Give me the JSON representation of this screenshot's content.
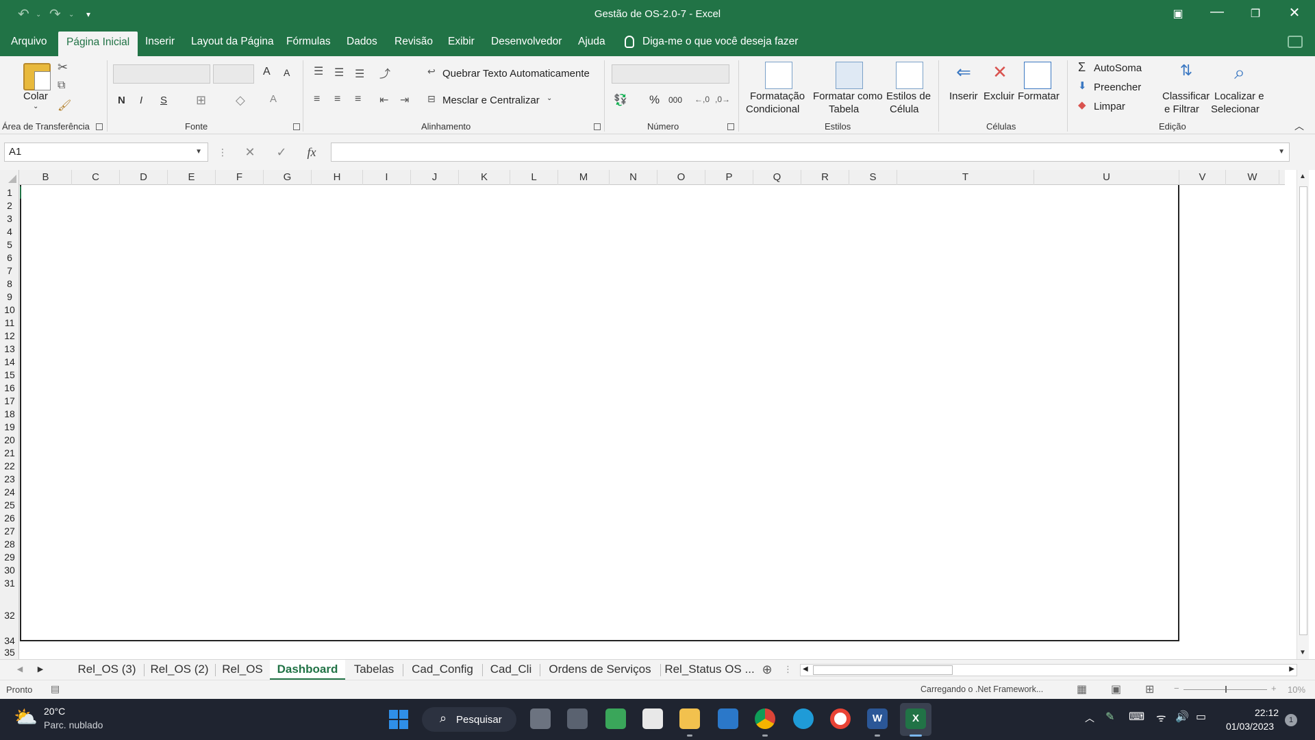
{
  "titlebar": {
    "title": "Gestão de OS-2.0-7  -  Excel",
    "undo_icon": "undo-icon",
    "redo_icon": "redo-icon",
    "customize_icon": "customize-qat-icon",
    "ribbon_display_icon": "ribbon-display-options-icon",
    "minimize_icon": "minimize-icon",
    "restore_icon": "restore-icon",
    "close_icon": "close-icon"
  },
  "menu": {
    "tabs": [
      "Arquivo",
      "Página Inicial",
      "Inserir",
      "Layout da Página",
      "Fórmulas",
      "Dados",
      "Revisão",
      "Exibir",
      "Desenvolvedor",
      "Ajuda"
    ],
    "active_tab": "Página Inicial",
    "tell_me": "Diga-me o que você deseja fazer"
  },
  "ribbon": {
    "clipboard": {
      "paste": "Colar",
      "group": "Área de Transferência"
    },
    "font": {
      "grow": "A",
      "shrink": "A",
      "bold": "N",
      "italic": "I",
      "underline": "S",
      "font_color": "A",
      "group": "Fonte"
    },
    "alignment": {
      "wrap_text": "Quebrar Texto Automaticamente",
      "merge_center": "Mesclar e Centralizar",
      "group": "Alinhamento"
    },
    "number": {
      "percent": "%",
      "thousands": "000",
      "group": "Número"
    },
    "styles": {
      "conditional_1": "Formatação",
      "conditional_2": "Condicional",
      "table_1": "Formatar como",
      "table_2": "Tabela",
      "cell_1": "Estilos de",
      "cell_2": "Célula",
      "group": "Estilos"
    },
    "cells": {
      "insert": "Inserir",
      "delete": "Excluir",
      "format": "Formatar",
      "group": "Células"
    },
    "editing": {
      "autosum": "AutoSoma",
      "fill": "Preencher",
      "clear": "Limpar",
      "sort_1": "Classificar",
      "sort_2": "e Filtrar",
      "find_1": "Localizar e",
      "find_2": "Selecionar",
      "group": "Edição"
    }
  },
  "formula_bar": {
    "name_box": "A1",
    "cancel": "✕",
    "enter": "✓",
    "fx": "fx",
    "value": ""
  },
  "grid": {
    "columns": [
      "B",
      "C",
      "D",
      "E",
      "F",
      "G",
      "H",
      "I",
      "J",
      "K",
      "L",
      "M",
      "N",
      "O",
      "P",
      "Q",
      "R",
      "S",
      "T",
      "U",
      "V",
      "W"
    ],
    "rows": [
      "1",
      "2",
      "3",
      "4",
      "5",
      "6",
      "7",
      "8",
      "9",
      "10",
      "11",
      "12",
      "13",
      "14",
      "15",
      "16",
      "17",
      "18",
      "19",
      "20",
      "21",
      "22",
      "23",
      "24",
      "25",
      "26",
      "27",
      "28",
      "29",
      "30",
      "31",
      "32",
      "34",
      "35"
    ]
  },
  "sheets": {
    "tabs": [
      "Rel_OS (3)",
      "Rel_OS (2)",
      "Rel_OS",
      "Dashboard",
      "Tabelas",
      "Cad_Config",
      "Cad_Cli",
      "Ordens de Serviços",
      "Rel_Status OS ..."
    ],
    "active": "Dashboard",
    "add_icon": "add-sheet-icon"
  },
  "status": {
    "ready": "Pronto",
    "loading": "Carregando o .Net Framework...",
    "zoom": "10%",
    "zoom_minus": "−",
    "zoom_plus": "+"
  },
  "taskbar": {
    "weather_temp": "20°C",
    "weather_desc": "Parc. nublado",
    "search": "Pesquisar",
    "time": "22:12",
    "date": "01/03/2023",
    "notification_count": "1",
    "colors": {
      "excel": "#217346",
      "word": "#2b5797",
      "windows": "#2f8fe8"
    }
  }
}
